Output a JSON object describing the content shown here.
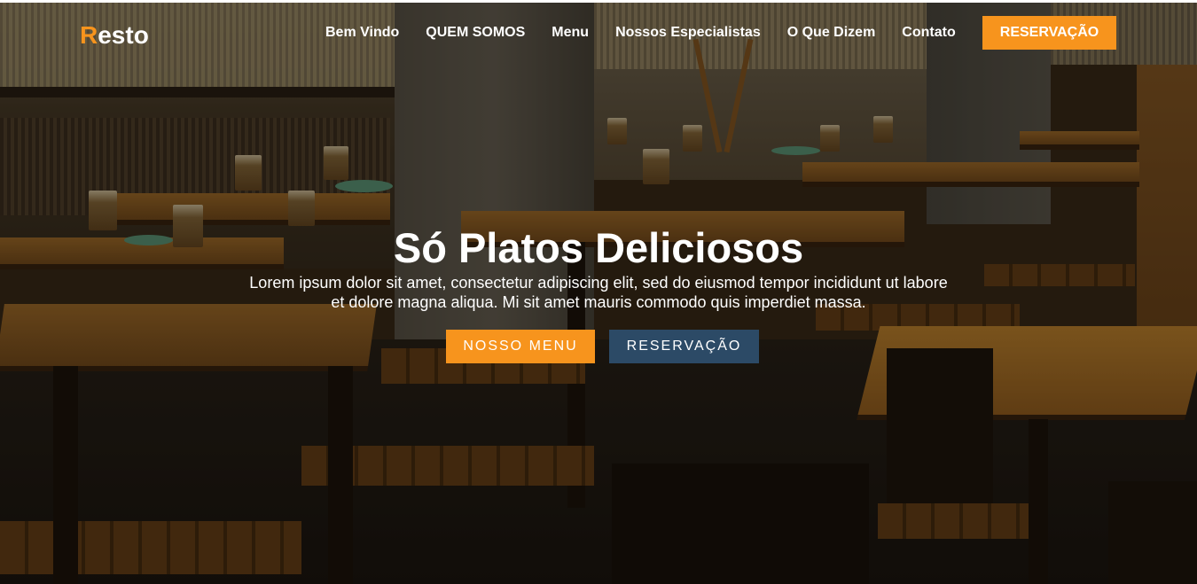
{
  "brand": {
    "logo_initial": "R",
    "logo_rest": "esto"
  },
  "nav": {
    "links": [
      {
        "label": "Bem Vindo"
      },
      {
        "label": "QUEM SOMOS"
      },
      {
        "label": "Menu"
      },
      {
        "label": "Nossos Especialistas"
      },
      {
        "label": "O Que Dizem"
      },
      {
        "label": "Contato"
      }
    ],
    "cta_label": "RESERVAÇÃO"
  },
  "hero": {
    "title": "Só Platos Deliciosos",
    "text": "Lorem ipsum dolor sit amet, consectetur adipiscing elit, sed do eiusmod tempor incididunt ut labore et dolore magna aliqua. Mi sit amet mauris commodo quis imperdiet massa.",
    "primary_button": "NOSSO MENU",
    "secondary_button": "RESERVAÇÃO"
  },
  "colors": {
    "accent": "#f7941d",
    "secondary": "#2c4a66",
    "text": "#ffffff"
  }
}
